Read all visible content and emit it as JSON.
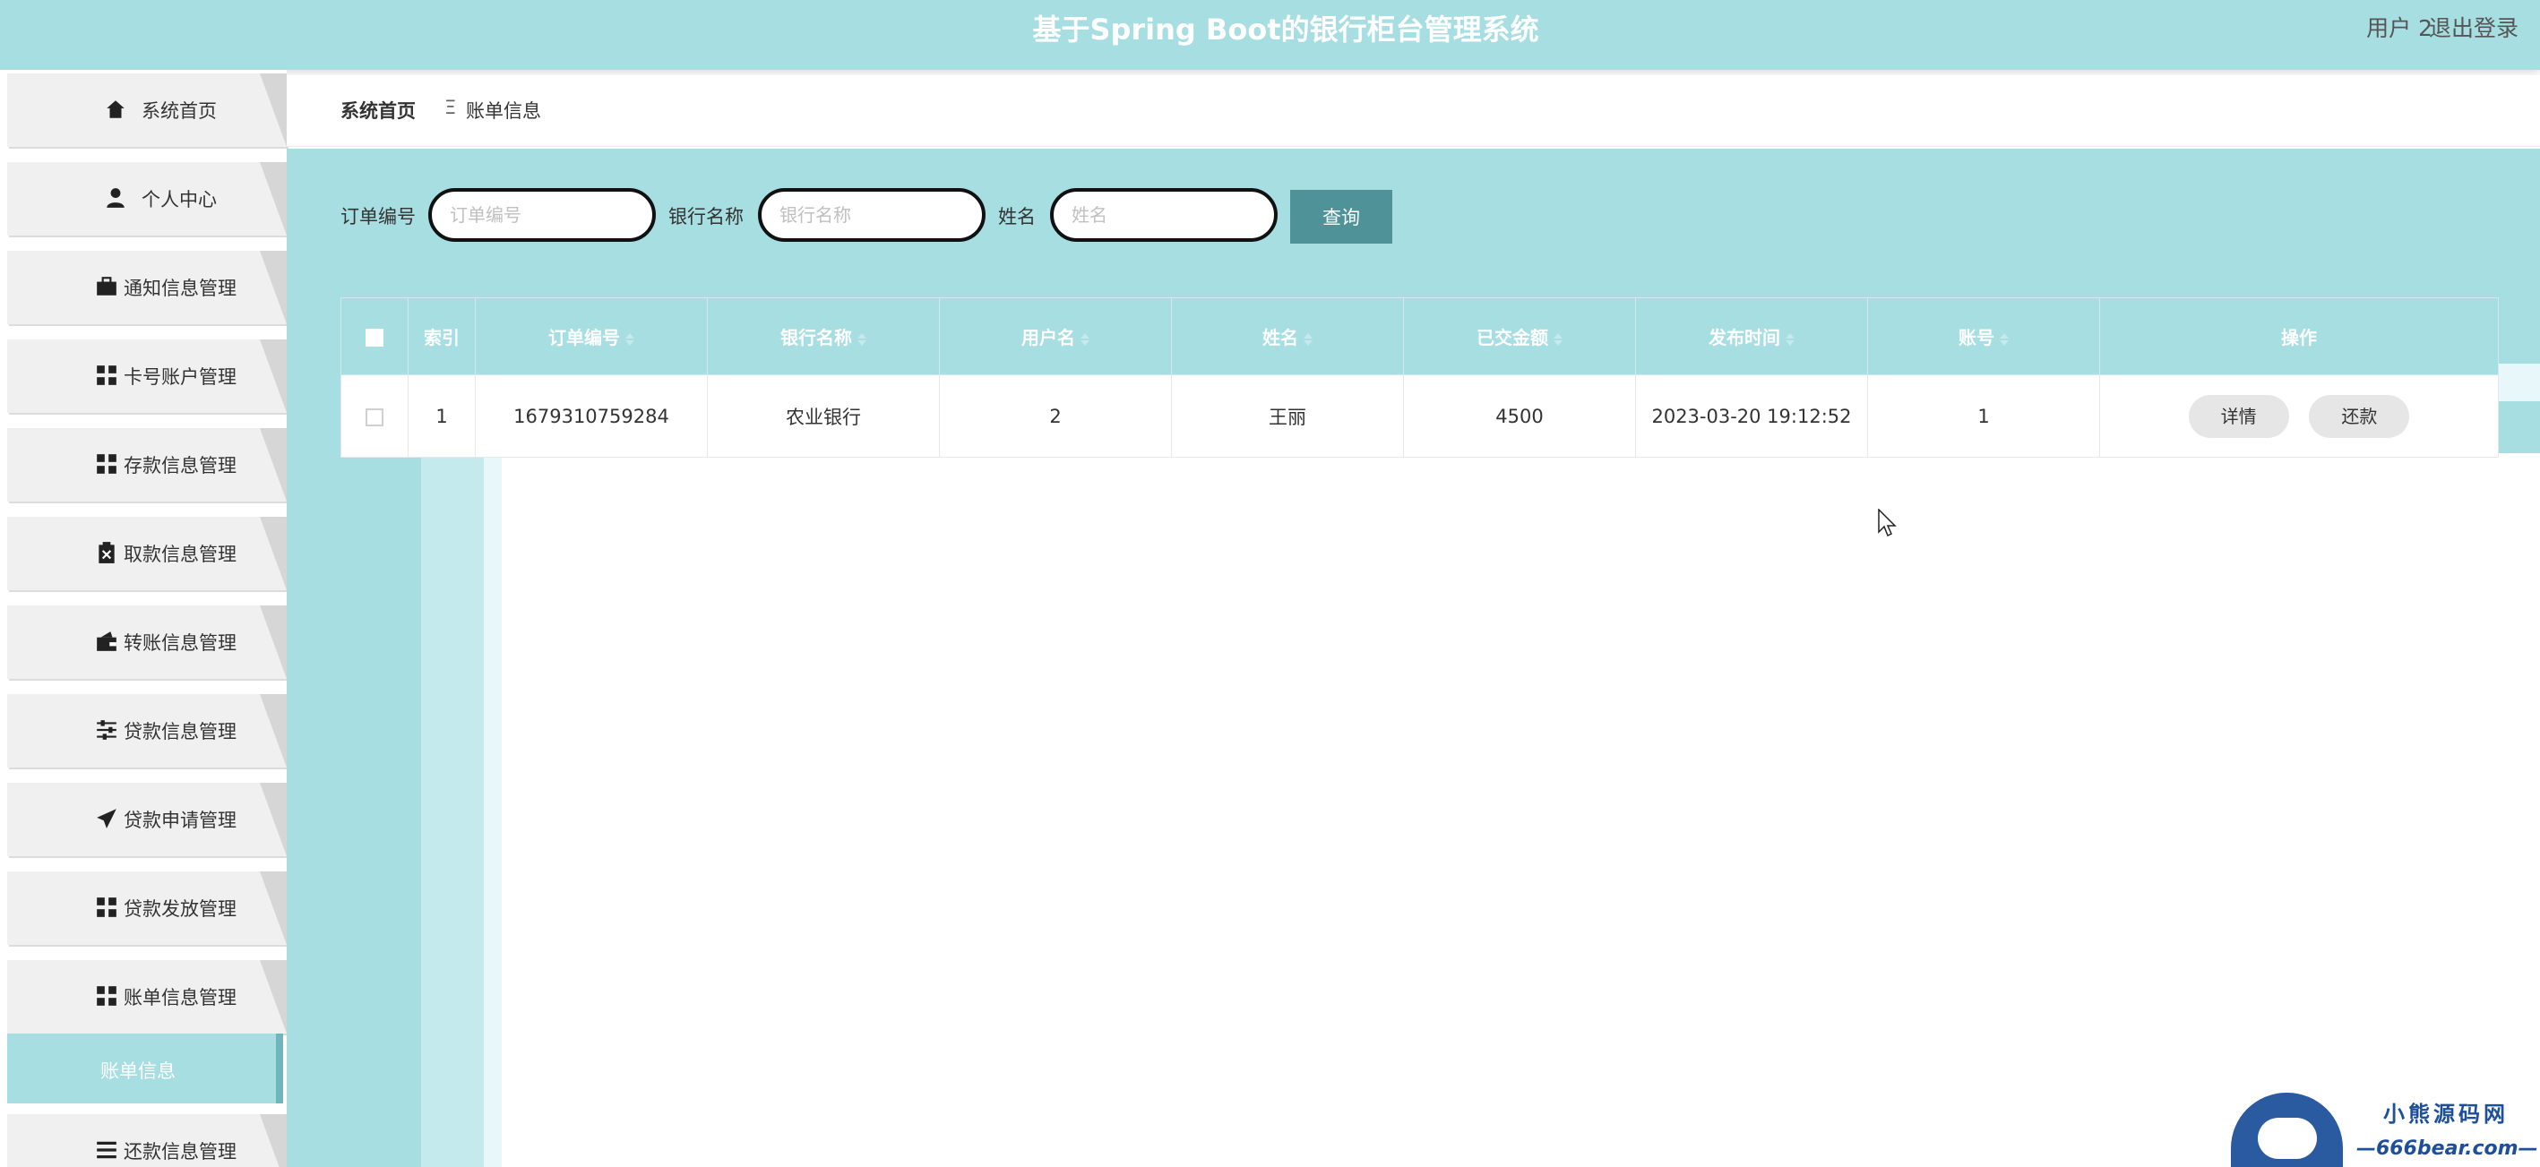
{
  "header": {
    "title": "基于Spring Boot的银行柜台管理系统",
    "user": "用户 2",
    "logout": "退出登录"
  },
  "sidebar": {
    "items": [
      {
        "label": "系统首页",
        "icon": "home-icon"
      },
      {
        "label": "个人中心",
        "icon": "user-icon"
      },
      {
        "label": "通知信息管理",
        "icon": "briefcase-icon"
      },
      {
        "label": "卡号账户管理",
        "icon": "grid-icon"
      },
      {
        "label": "存款信息管理",
        "icon": "grid-icon"
      },
      {
        "label": "取款信息管理",
        "icon": "clipboard-icon"
      },
      {
        "label": "转账信息管理",
        "icon": "wallet-icon"
      },
      {
        "label": "贷款信息管理",
        "icon": "sliders-icon"
      },
      {
        "label": "贷款申请管理",
        "icon": "send-icon"
      },
      {
        "label": "贷款发放管理",
        "icon": "grid-icon"
      },
      {
        "label": "账单信息管理",
        "icon": "grid-icon"
      },
      {
        "label": "还款信息管理",
        "icon": "list-icon"
      }
    ],
    "sub_active": "账单信息"
  },
  "breadcrumb": {
    "home": "系统首页",
    "separator": "Ξ",
    "current": "账单信息"
  },
  "search": {
    "order_label": "订单编号",
    "order_placeholder": "订单编号",
    "bank_label": "银行名称",
    "bank_placeholder": "银行名称",
    "name_label": "姓名",
    "name_placeholder": "姓名",
    "query_button": "查询"
  },
  "table": {
    "headers": [
      "索引",
      "订单编号",
      "银行名称",
      "用户名",
      "姓名",
      "已交金额",
      "发布时间",
      "账号",
      "操作"
    ],
    "rows": [
      {
        "index": "1",
        "order_no": "1679310759284",
        "bank": "农业银行",
        "username": "2",
        "name": "王丽",
        "paid": "4500",
        "time": "2023-03-20 19:12:52",
        "account": "1",
        "detail": "详情",
        "repay": "还款"
      }
    ]
  },
  "watermark": {
    "line1": "小熊源码网",
    "line2": "—666bear.com—"
  },
  "colors": {
    "primary": "#a6dee2",
    "button": "#4f9399",
    "sub_active_border": "#6fb6bb"
  }
}
